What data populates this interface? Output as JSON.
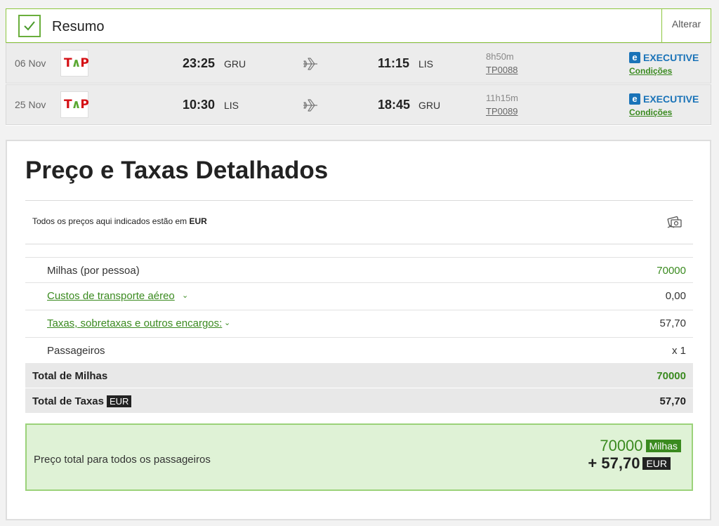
{
  "summary": {
    "title": "Resumo",
    "change_label": "Alterar",
    "flights": [
      {
        "date": "06 Nov",
        "airline_logo": "TAP",
        "dep_time": "23:25",
        "dep_code": "GRU",
        "arr_time": "11:15",
        "arr_code": "LIS",
        "duration": "8h50m",
        "flight_number": "TP0088",
        "cabin_icon": "e",
        "cabin": "EXECUTIVE",
        "conditions": "Condições"
      },
      {
        "date": "25 Nov",
        "airline_logo": "TAP",
        "dep_time": "10:30",
        "dep_code": "LIS",
        "arr_time": "18:45",
        "arr_code": "GRU",
        "duration": "11h15m",
        "flight_number": "TP0089",
        "cabin_icon": "e",
        "cabin": "EXECUTIVE",
        "conditions": "Condições"
      }
    ]
  },
  "pricing": {
    "title": "Preço e Taxas Detalhados",
    "currency_note_prefix": "Todos os preços aqui indicados estão em",
    "currency": "EUR",
    "rows": {
      "miles": {
        "label": "Milhas (por pessoa)",
        "value": "70000"
      },
      "transport": {
        "label": "Custos de transporte aéreo",
        "value": "0,00"
      },
      "taxes": {
        "label": "Taxas, sobretaxas e outros encargos:",
        "value": "57,70"
      },
      "passengers": {
        "label": "Passageiros",
        "value": "x 1"
      }
    },
    "totals": {
      "miles": {
        "label": "Total de Milhas",
        "value": "70000"
      },
      "taxes": {
        "label": "Total de Taxas",
        "tag": "EUR",
        "value": "57,70"
      }
    },
    "grand_total": {
      "label": "Preço total para todos os passageiros",
      "miles_value": "70000",
      "miles_tag": "Milhas",
      "eur_value": "+ 57,70",
      "eur_tag": "EUR"
    }
  },
  "colors": {
    "accent_green": "#3a8a1f",
    "border_green": "#8cc63f",
    "executive_blue": "#1a73b8",
    "grand_bg": "#dff2d6"
  },
  "icons": {
    "check": "check-icon",
    "plane": "plane-icon",
    "chevron": "chevron-down-icon",
    "money": "money-icon"
  }
}
